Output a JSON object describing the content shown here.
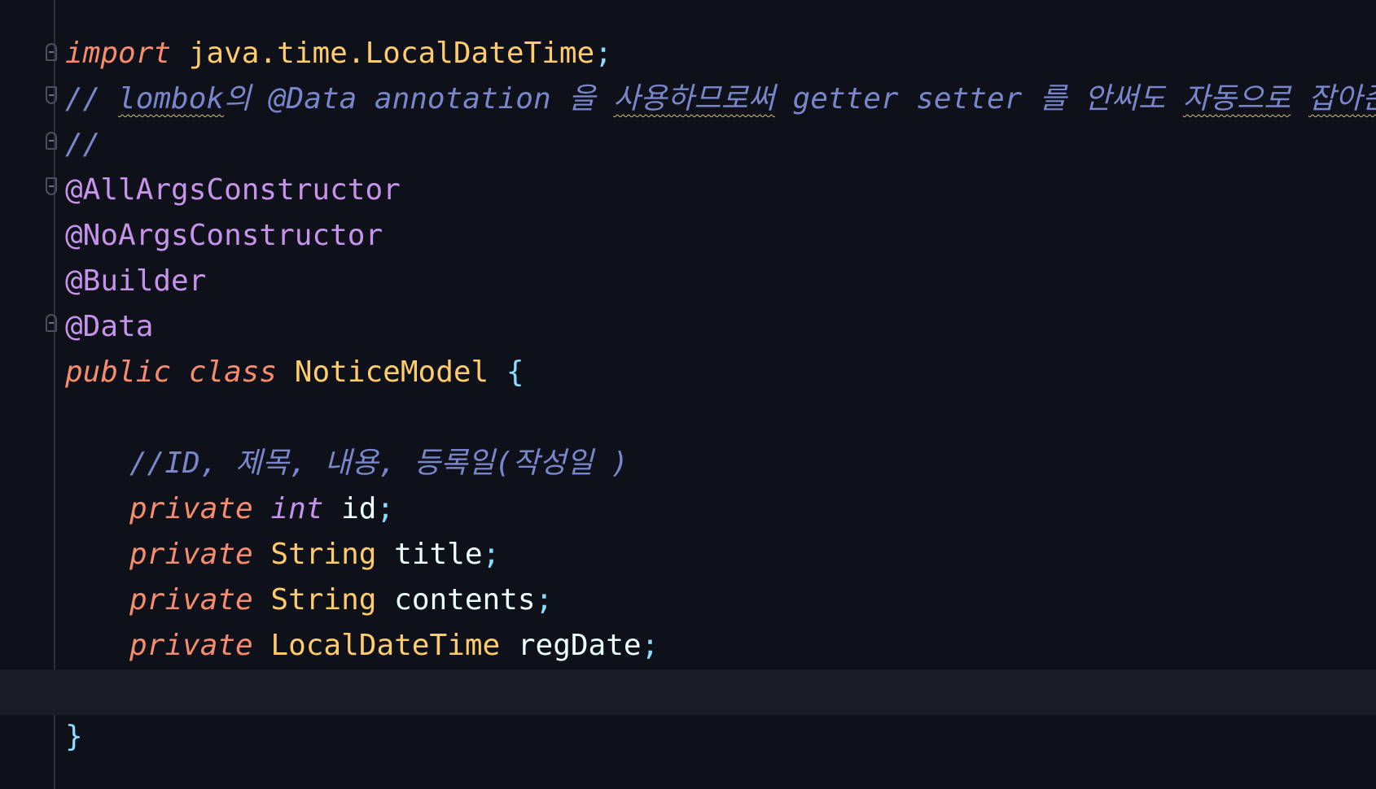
{
  "editor": {
    "language": "java",
    "theme_colors": {
      "background": "#0f111a",
      "keyword": "#f78c6c",
      "annotation": "#c792ea",
      "type": "#ffcb6b",
      "comment": "#7986cb",
      "punctuation": "#89ddff",
      "identifier": "#eeffff",
      "current_line": "#1a1c25"
    },
    "lines": {
      "import": {
        "keyword": "import",
        "package": "java.time.LocalDateTime",
        "semicolon": ";"
      },
      "comment1": {
        "prefix": "// ",
        "w1": "lombok",
        "t1": "의 @Data annotation 을 ",
        "w2": "사용하므로써",
        "t2": " getter setter 를 안써도 ",
        "w3": "자동으로",
        "t3": " ",
        "w4": "잡아준다",
        "t4": "."
      },
      "comment2": {
        "text": "//"
      },
      "annotations": [
        "@AllArgsConstructor",
        "@NoArgsConstructor",
        "@Builder",
        "@Data"
      ],
      "class_decl": {
        "kw_public": "public",
        "kw_class": "class",
        "name": "NoticeModel",
        "open_brace": "{"
      },
      "field_comment": {
        "text": "//ID, 제목, 내용, 등록일(작성일 )"
      },
      "fields": [
        {
          "modifier": "private",
          "type": "int",
          "name": "id",
          "semi": ";"
        },
        {
          "modifier": "private",
          "type": "String",
          "name": "title",
          "semi": ";"
        },
        {
          "modifier": "private",
          "type": "String",
          "name": "contents",
          "semi": ";"
        },
        {
          "modifier": "private",
          "type": "LocalDateTime",
          "name": "regDate",
          "semi": ";"
        }
      ],
      "close_brace": "}"
    },
    "icons": [
      "fold-icon"
    ]
  }
}
